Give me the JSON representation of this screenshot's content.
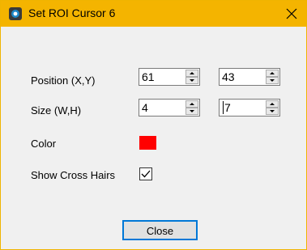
{
  "window": {
    "title": "Set ROI Cursor 6",
    "icon": "app-target-icon",
    "close_icon": "close-icon"
  },
  "form": {
    "position": {
      "label": "Position (X,Y)",
      "x": "61",
      "y": "43"
    },
    "size": {
      "label": "Size (W,H)",
      "w": "4",
      "h": "7"
    },
    "color": {
      "label": "Color",
      "value": "#ff0000"
    },
    "cross_hairs": {
      "label": "Show Cross Hairs",
      "checked": true
    }
  },
  "buttons": {
    "close_label": "Close"
  },
  "colors": {
    "titlebar": "#f4b400",
    "accent": "#0078d7"
  }
}
